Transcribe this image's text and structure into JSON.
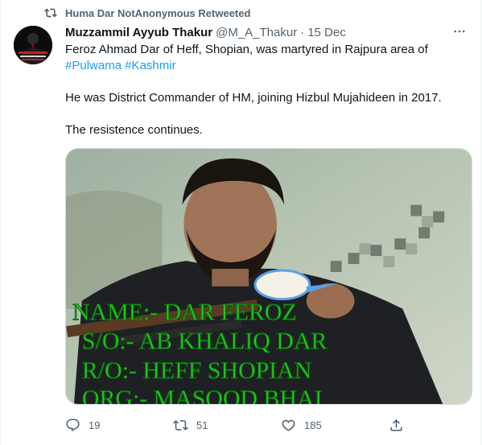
{
  "retweet_context": {
    "label": "Huma Dar NotAnonymous Retweeted",
    "icon": "retweet-icon"
  },
  "author": {
    "display_name": "Muzzammil Ayyub Thakur",
    "handle": "@M_A_Thakur",
    "separator": "·",
    "date": "15 Dec",
    "avatar_caption": "Never Forget Never Forgive"
  },
  "body": {
    "line1": "Feroz Ahmad Dar of Heff, Shopian, was martyred in Rajpura area of",
    "hashtag1": "#Pulwama",
    "hashtag2": "#Kashmir",
    "line2": "He was District Commander of HM, joining Hizbul Mujahideen in 2017.",
    "line3": "The resistence continues."
  },
  "media": {
    "overlay_lines": [
      "NAME:- DAR FEROZ",
      "S/O:- AB KHALIQ DAR",
      "R/O:- HEFF SHOPIAN",
      "ORG:- MASOOD BHAI"
    ],
    "overlay_color": "#1fd01f"
  },
  "actions": {
    "reply_count": "19",
    "retweet_count": "51",
    "like_count": "185",
    "reply_icon": "reply-icon",
    "retweet_icon": "retweet-icon",
    "like_icon": "heart-icon",
    "share_icon": "share-icon"
  },
  "colors": {
    "link": "#1d9bf0",
    "secondary_text": "#536471",
    "primary_text": "#0f1419"
  }
}
